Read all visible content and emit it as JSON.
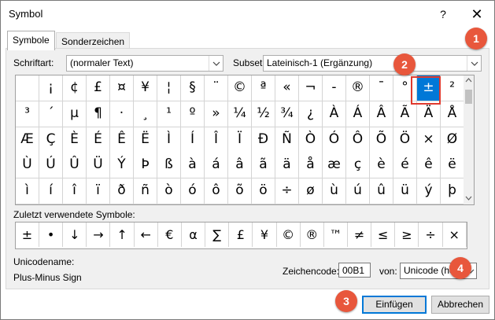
{
  "window": {
    "title": "Symbol",
    "help": "?",
    "close": "✕"
  },
  "tabs": [
    {
      "label": "Symbole"
    },
    {
      "label": "Sonderzeichen"
    }
  ],
  "font": {
    "label": "Schriftart:",
    "value": "(normaler Text)"
  },
  "subset": {
    "label": "Subset:",
    "value": "Lateinisch-1 (Ergänzung)"
  },
  "grid": {
    "rows": [
      [
        " ",
        "¡",
        "¢",
        "£",
        "¤",
        "¥",
        "¦",
        "§",
        "¨",
        "©",
        "ª",
        "«",
        "¬",
        "-",
        "®",
        "¯",
        "°",
        "±",
        "²"
      ],
      [
        "³",
        "´",
        "µ",
        "¶",
        "·",
        "¸",
        "¹",
        "º",
        "»",
        "¼",
        "½",
        "¾",
        "¿",
        "À",
        "Á",
        "Â",
        "Ã",
        "Ä",
        "Å"
      ],
      [
        "Æ",
        "Ç",
        "È",
        "É",
        "Ê",
        "Ë",
        "Ì",
        "Í",
        "Î",
        "Ï",
        "Ð",
        "Ñ",
        "Ò",
        "Ó",
        "Ô",
        "Õ",
        "Ö",
        "×",
        "Ø"
      ],
      [
        "Ù",
        "Ú",
        "Û",
        "Ü",
        "Ý",
        "Þ",
        "ß",
        "à",
        "á",
        "â",
        "ã",
        "ä",
        "å",
        "æ",
        "ç",
        "è",
        "é",
        "ê",
        "ë"
      ],
      [
        "ì",
        "í",
        "î",
        "ï",
        "ð",
        "ñ",
        "ò",
        "ó",
        "ô",
        "õ",
        "ö",
        "÷",
        "ø",
        "ù",
        "ú",
        "û",
        "ü",
        "ý",
        "þ"
      ]
    ],
    "selected": "±"
  },
  "recent": {
    "label": "Zuletzt verwendete Symbole:",
    "symbols": [
      "±",
      "•",
      "↓",
      "→",
      "↑",
      "←",
      "€",
      "α",
      "∑",
      "£",
      "¥",
      "©",
      "®",
      "™",
      "≠",
      "≤",
      "≥",
      "÷",
      "×"
    ]
  },
  "unicode_name": {
    "label": "Unicodename:",
    "value": "Plus-Minus Sign"
  },
  "char_code": {
    "label": "Zeichencode:",
    "value": "00B1"
  },
  "from": {
    "label": "von:",
    "value": "Unicode (hex)"
  },
  "buttons": {
    "insert": "Einfügen",
    "cancel": "Abbrechen"
  },
  "annotations": [
    "1",
    "2",
    "3",
    "4"
  ],
  "colors": {
    "accent": "#0078d7",
    "badge": "#e8573c",
    "highlight": "#e03a2e"
  }
}
